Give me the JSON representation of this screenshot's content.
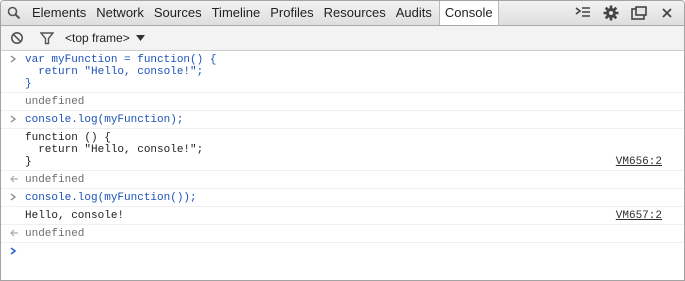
{
  "tabs": [
    {
      "label": "Elements"
    },
    {
      "label": "Network"
    },
    {
      "label": "Sources"
    },
    {
      "label": "Timeline"
    },
    {
      "label": "Profiles"
    },
    {
      "label": "Resources"
    },
    {
      "label": "Audits"
    },
    {
      "label": "Console",
      "selected": true
    }
  ],
  "tabbar_icons": [
    "search-icon",
    "drawer-icon",
    "settings-gear-icon",
    "dock-icon",
    "close-icon"
  ],
  "toolbar": {
    "frame_selector": "<top frame>"
  },
  "console": {
    "entries": [
      {
        "kind": "command",
        "text": "var myFunction = function() {\n  return \"Hello, console!\";\n}"
      },
      {
        "kind": "result",
        "text": "undefined"
      },
      {
        "kind": "command",
        "text": "console.log(myFunction);"
      },
      {
        "kind": "log",
        "text": "function () {\n  return \"Hello, console!\";\n}",
        "source": "VM656:2"
      },
      {
        "kind": "result",
        "text": "undefined"
      },
      {
        "kind": "command",
        "text": "console.log(myFunction());"
      },
      {
        "kind": "log",
        "text": "Hello, console!",
        "source": "VM657:2"
      },
      {
        "kind": "result",
        "text": "undefined"
      }
    ]
  },
  "colors": {
    "command_text": "#1c52b8",
    "result_text": "#6d6d6d",
    "prompt_caret": "#2a63d0"
  }
}
